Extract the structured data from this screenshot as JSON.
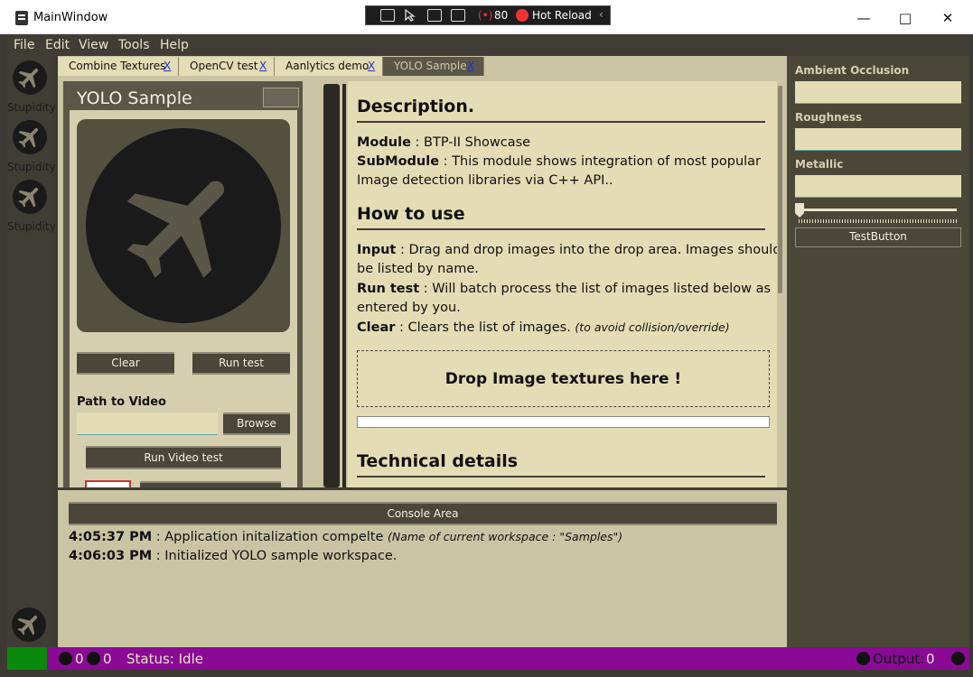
{
  "window": {
    "title": "MainWindow"
  },
  "devbar": {
    "count": "80",
    "hot_reload": "Hot Reload"
  },
  "menu": [
    "File",
    "Edit",
    "View",
    "Tools",
    "Help"
  ],
  "sidebar": {
    "items": [
      {
        "label": "Stupidity"
      },
      {
        "label": "Stupidity"
      },
      {
        "label": "Stupidity"
      }
    ]
  },
  "tabs": [
    {
      "label": "Combine Textures",
      "close": "X"
    },
    {
      "label": "OpenCV test",
      "close": "X"
    },
    {
      "label": "Aanlytics demo",
      "close": "X"
    },
    {
      "label": "YOLO Sample",
      "close": "X"
    }
  ],
  "yolo": {
    "title": "YOLO Sample",
    "clear_label": "Clear",
    "run_test_label": "Run test",
    "path_label": "Path to Video",
    "path_value": "",
    "browse_label": "Browse",
    "run_video_label": "Run Video test"
  },
  "doc": {
    "description_heading": "Description.",
    "module_key": "Module",
    "module_value": " : BTP-II Showcase",
    "submodule_key": "SubModule",
    "submodule_value": " : This module shows integration of most popular",
    "submodule_value2": "Image detection libraries via C++ API..",
    "howto_heading": "How to use",
    "input_key": "Input",
    "input_value": " : Drag and drop images into the drop area. Images should",
    "input_value2": "be listed by name.",
    "runtest_key": "Run test",
    "runtest_value": " : Will batch process the list of images listed below as",
    "runtest_value2": "entered by you.",
    "clear_key": "Clear",
    "clear_value": " : Clears the list of images. ",
    "clear_note": "(to avoid collision/override)",
    "drop_label": "Drop Image textures here !",
    "tech_heading": "Technical details"
  },
  "console": {
    "title": "Console Area",
    "logs": [
      {
        "time": "4:05:37 PM",
        "msg": " : Application initalization compelte ",
        "note": "(Name of current workspace : \"Samples\")"
      },
      {
        "time": "4:06:03 PM",
        "msg": " : Initialized YOLO sample workspace.",
        "note": ""
      }
    ]
  },
  "props": {
    "ao_label": "Ambient Occlusion",
    "ao_value": "",
    "roughness_label": "Roughness",
    "roughness_value": "",
    "metallic_label": "Metallic",
    "metallic_value": "",
    "slider_value": 0,
    "test_button_label": "TestButton"
  },
  "status": {
    "errors": "0",
    "warnings": "0",
    "status_text": "Status: Idle",
    "output_label": "Output:",
    "output_count": "0"
  }
}
